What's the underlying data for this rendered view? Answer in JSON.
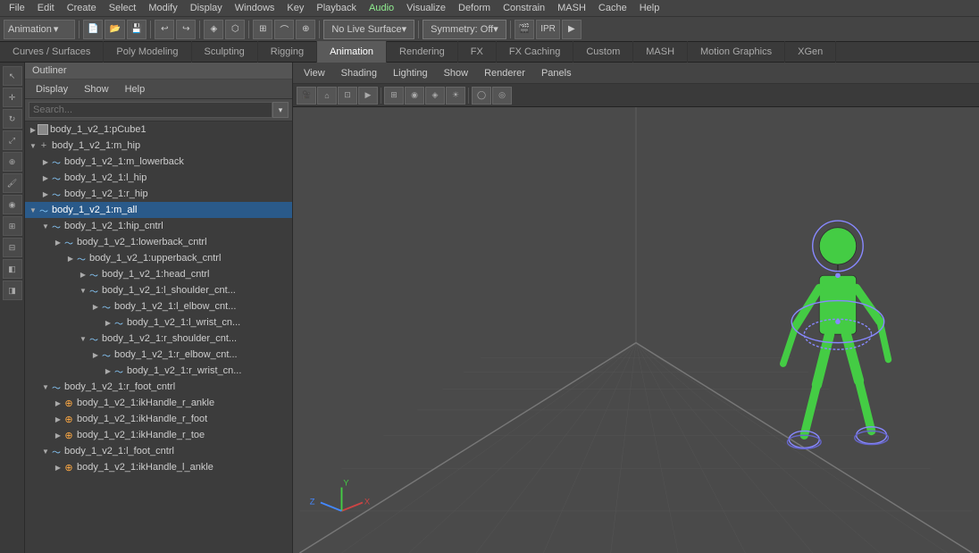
{
  "menubar": {
    "items": [
      "File",
      "Edit",
      "Create",
      "Select",
      "Modify",
      "Display",
      "Windows",
      "Key",
      "Playback",
      "Audio",
      "Visualize",
      "Deform",
      "Constrain",
      "MASH",
      "Cache",
      "Help"
    ]
  },
  "toolbar": {
    "workspace_dropdown": "Animation",
    "symmetry_btn": "Symmetry: Off",
    "no_live_surface": "No Live Surface"
  },
  "tabs": [
    {
      "label": "Curves / Surfaces",
      "active": false
    },
    {
      "label": "Poly Modeling",
      "active": false
    },
    {
      "label": "Sculpting",
      "active": false
    },
    {
      "label": "Rigging",
      "active": false
    },
    {
      "label": "Animation",
      "active": true
    },
    {
      "label": "Rendering",
      "active": false
    },
    {
      "label": "FX",
      "active": false
    },
    {
      "label": "FX Caching",
      "active": false
    },
    {
      "label": "Custom",
      "active": false
    },
    {
      "label": "MASH",
      "active": false
    },
    {
      "label": "Motion Graphics",
      "active": false
    },
    {
      "label": "XGen",
      "active": false
    }
  ],
  "outliner": {
    "title": "Outliner",
    "menu_items": [
      "Display",
      "Show",
      "Help"
    ],
    "search_placeholder": "Search...",
    "tree_items": [
      {
        "id": 1,
        "label": "body_1_v2_1:pCube1",
        "indent": 0,
        "type": "mesh",
        "expanded": false,
        "selected": false
      },
      {
        "id": 2,
        "label": "body_1_v2_1:m_hip",
        "indent": 0,
        "type": "group",
        "expanded": true,
        "selected": false
      },
      {
        "id": 3,
        "label": "body_1_v2_1:m_lowerback",
        "indent": 1,
        "type": "curve",
        "expanded": false,
        "selected": false
      },
      {
        "id": 4,
        "label": "body_1_v2_1:l_hip",
        "indent": 1,
        "type": "curve",
        "expanded": false,
        "selected": false
      },
      {
        "id": 5,
        "label": "body_1_v2_1:r_hip",
        "indent": 1,
        "type": "curve",
        "expanded": false,
        "selected": false
      },
      {
        "id": 6,
        "label": "body_1_v2_1:m_all",
        "indent": 0,
        "type": "curve",
        "expanded": true,
        "selected": true
      },
      {
        "id": 7,
        "label": "body_1_v2_1:hip_cntrl",
        "indent": 1,
        "type": "curve",
        "expanded": true,
        "selected": false
      },
      {
        "id": 8,
        "label": "body_1_v2_1:lowerback_cntrl",
        "indent": 2,
        "type": "curve",
        "expanded": false,
        "selected": false
      },
      {
        "id": 9,
        "label": "body_1_v2_1:upperback_cntrl",
        "indent": 3,
        "type": "curve",
        "expanded": false,
        "selected": false
      },
      {
        "id": 10,
        "label": "body_1_v2_1:head_cntrl",
        "indent": 4,
        "type": "curve",
        "expanded": false,
        "selected": false
      },
      {
        "id": 11,
        "label": "body_1_v2_1:l_shoulder_cnt...",
        "indent": 4,
        "type": "curve",
        "expanded": true,
        "selected": false
      },
      {
        "id": 12,
        "label": "body_1_v2_1:l_elbow_cnt...",
        "indent": 5,
        "type": "curve",
        "expanded": false,
        "selected": false
      },
      {
        "id": 13,
        "label": "body_1_v2_1:l_wrist_cn...",
        "indent": 6,
        "type": "curve",
        "expanded": false,
        "selected": false
      },
      {
        "id": 14,
        "label": "body_1_v2_1:r_shoulder_cnt...",
        "indent": 4,
        "type": "curve",
        "expanded": true,
        "selected": false
      },
      {
        "id": 15,
        "label": "body_1_v2_1:r_elbow_cnt...",
        "indent": 5,
        "type": "curve",
        "expanded": false,
        "selected": false
      },
      {
        "id": 16,
        "label": "body_1_v2_1:r_wrist_cn...",
        "indent": 6,
        "type": "curve",
        "expanded": false,
        "selected": false
      },
      {
        "id": 17,
        "label": "body_1_v2_1:r_foot_cntrl",
        "indent": 1,
        "type": "curve",
        "expanded": true,
        "selected": false
      },
      {
        "id": 18,
        "label": "body_1_v2_1:ikHandle_r_ankle",
        "indent": 2,
        "type": "ik",
        "expanded": false,
        "selected": false
      },
      {
        "id": 19,
        "label": "body_1_v2_1:ikHandle_r_foot",
        "indent": 2,
        "type": "ik",
        "expanded": false,
        "selected": false
      },
      {
        "id": 20,
        "label": "body_1_v2_1:ikHandle_r_toe",
        "indent": 2,
        "type": "ik",
        "expanded": false,
        "selected": false
      },
      {
        "id": 21,
        "label": "body_1_v2_1:l_foot_cntrl",
        "indent": 1,
        "type": "curve",
        "expanded": true,
        "selected": false
      },
      {
        "id": 22,
        "label": "body_1_v2_1:ikHandle_l_ankle",
        "indent": 2,
        "type": "ik",
        "expanded": false,
        "selected": false
      }
    ]
  },
  "viewport": {
    "menu_items": [
      "View",
      "Shading",
      "Lighting",
      "Show",
      "Renderer",
      "Panels"
    ]
  },
  "colors": {
    "selected_bg": "#2a5a8a",
    "active_tab": "#5a5a5a",
    "character_body": "#44cc44",
    "character_head": "#44cc44",
    "grid_line": "#555555",
    "axis_x": "#cc4444",
    "axis_y": "#44cc44",
    "axis_z": "#4444cc"
  }
}
